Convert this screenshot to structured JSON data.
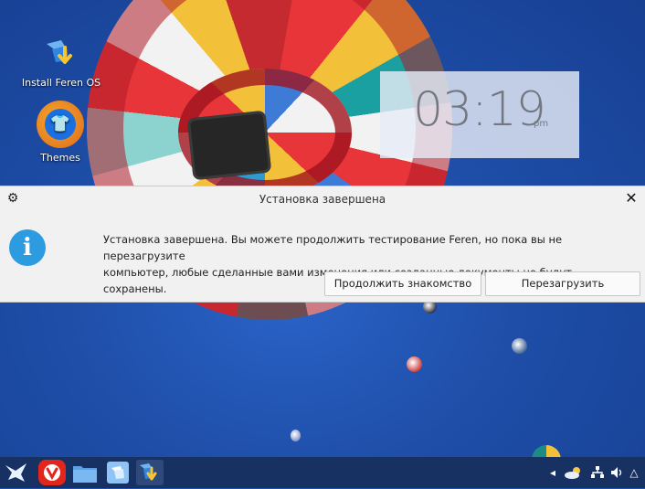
{
  "desktop": {
    "icons": [
      {
        "label": "Install Feren OS"
      },
      {
        "label": "Themes"
      }
    ]
  },
  "clock": {
    "time": "03:19",
    "ampm": "pm"
  },
  "dialog": {
    "title": "Установка завершена",
    "message_line1": "Установка завершена. Вы можете продолжить тестирование Feren, но пока вы не перезагрузите",
    "message_line2": "компьютер, любые сделанные вами изменения или созданные документы не будут сохранены.",
    "buttons": {
      "continue": "Продолжить знакомство",
      "restart": "Перезагрузить"
    }
  },
  "taskbar": {
    "launcher_icon": "feren-bird-icon",
    "apps": [
      "vivaldi-icon",
      "file-manager-icon",
      "document-viewer-icon",
      "installer-icon"
    ],
    "tray": [
      "show-desktop-icon",
      "weather-icon",
      "network-icon",
      "volume-icon",
      "menu-arrow-icon"
    ]
  },
  "colors": {
    "desktop_bg": "#1f4fb0",
    "dialog_bg": "#f1f1f1",
    "info_blue": "#2c9be0",
    "taskbar_bg": "#173262",
    "vivaldi_red": "#e2261c",
    "folder_blue": "#5aa0e6"
  }
}
